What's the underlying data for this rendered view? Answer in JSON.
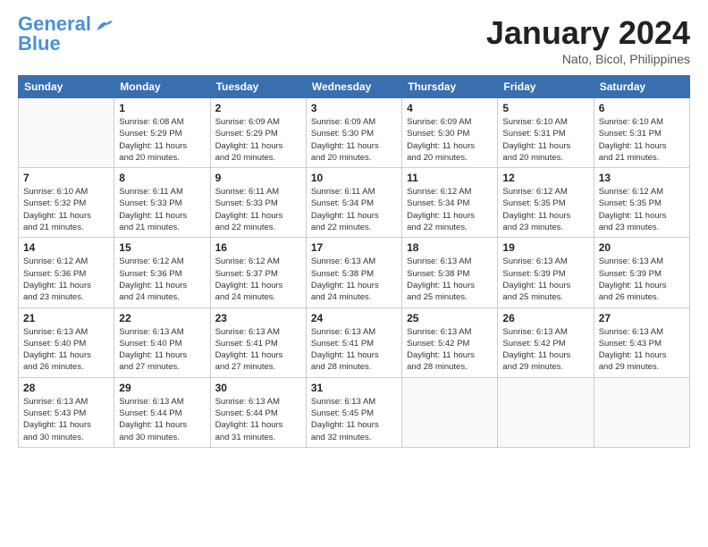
{
  "header": {
    "logo_line1": "General",
    "logo_line2": "Blue",
    "title": "January 2024",
    "subtitle": "Nato, Bicol, Philippines"
  },
  "weekdays": [
    "Sunday",
    "Monday",
    "Tuesday",
    "Wednesday",
    "Thursday",
    "Friday",
    "Saturday"
  ],
  "weeks": [
    [
      {
        "day": "",
        "info": ""
      },
      {
        "day": "1",
        "info": "Sunrise: 6:08 AM\nSunset: 5:29 PM\nDaylight: 11 hours\nand 20 minutes."
      },
      {
        "day": "2",
        "info": "Sunrise: 6:09 AM\nSunset: 5:29 PM\nDaylight: 11 hours\nand 20 minutes."
      },
      {
        "day": "3",
        "info": "Sunrise: 6:09 AM\nSunset: 5:30 PM\nDaylight: 11 hours\nand 20 minutes."
      },
      {
        "day": "4",
        "info": "Sunrise: 6:09 AM\nSunset: 5:30 PM\nDaylight: 11 hours\nand 20 minutes."
      },
      {
        "day": "5",
        "info": "Sunrise: 6:10 AM\nSunset: 5:31 PM\nDaylight: 11 hours\nand 20 minutes."
      },
      {
        "day": "6",
        "info": "Sunrise: 6:10 AM\nSunset: 5:31 PM\nDaylight: 11 hours\nand 21 minutes."
      }
    ],
    [
      {
        "day": "7",
        "info": "Sunrise: 6:10 AM\nSunset: 5:32 PM\nDaylight: 11 hours\nand 21 minutes."
      },
      {
        "day": "8",
        "info": "Sunrise: 6:11 AM\nSunset: 5:33 PM\nDaylight: 11 hours\nand 21 minutes."
      },
      {
        "day": "9",
        "info": "Sunrise: 6:11 AM\nSunset: 5:33 PM\nDaylight: 11 hours\nand 22 minutes."
      },
      {
        "day": "10",
        "info": "Sunrise: 6:11 AM\nSunset: 5:34 PM\nDaylight: 11 hours\nand 22 minutes."
      },
      {
        "day": "11",
        "info": "Sunrise: 6:12 AM\nSunset: 5:34 PM\nDaylight: 11 hours\nand 22 minutes."
      },
      {
        "day": "12",
        "info": "Sunrise: 6:12 AM\nSunset: 5:35 PM\nDaylight: 11 hours\nand 23 minutes."
      },
      {
        "day": "13",
        "info": "Sunrise: 6:12 AM\nSunset: 5:35 PM\nDaylight: 11 hours\nand 23 minutes."
      }
    ],
    [
      {
        "day": "14",
        "info": "Sunrise: 6:12 AM\nSunset: 5:36 PM\nDaylight: 11 hours\nand 23 minutes."
      },
      {
        "day": "15",
        "info": "Sunrise: 6:12 AM\nSunset: 5:36 PM\nDaylight: 11 hours\nand 24 minutes."
      },
      {
        "day": "16",
        "info": "Sunrise: 6:12 AM\nSunset: 5:37 PM\nDaylight: 11 hours\nand 24 minutes."
      },
      {
        "day": "17",
        "info": "Sunrise: 6:13 AM\nSunset: 5:38 PM\nDaylight: 11 hours\nand 24 minutes."
      },
      {
        "day": "18",
        "info": "Sunrise: 6:13 AM\nSunset: 5:38 PM\nDaylight: 11 hours\nand 25 minutes."
      },
      {
        "day": "19",
        "info": "Sunrise: 6:13 AM\nSunset: 5:39 PM\nDaylight: 11 hours\nand 25 minutes."
      },
      {
        "day": "20",
        "info": "Sunrise: 6:13 AM\nSunset: 5:39 PM\nDaylight: 11 hours\nand 26 minutes."
      }
    ],
    [
      {
        "day": "21",
        "info": "Sunrise: 6:13 AM\nSunset: 5:40 PM\nDaylight: 11 hours\nand 26 minutes."
      },
      {
        "day": "22",
        "info": "Sunrise: 6:13 AM\nSunset: 5:40 PM\nDaylight: 11 hours\nand 27 minutes."
      },
      {
        "day": "23",
        "info": "Sunrise: 6:13 AM\nSunset: 5:41 PM\nDaylight: 11 hours\nand 27 minutes."
      },
      {
        "day": "24",
        "info": "Sunrise: 6:13 AM\nSunset: 5:41 PM\nDaylight: 11 hours\nand 28 minutes."
      },
      {
        "day": "25",
        "info": "Sunrise: 6:13 AM\nSunset: 5:42 PM\nDaylight: 11 hours\nand 28 minutes."
      },
      {
        "day": "26",
        "info": "Sunrise: 6:13 AM\nSunset: 5:42 PM\nDaylight: 11 hours\nand 29 minutes."
      },
      {
        "day": "27",
        "info": "Sunrise: 6:13 AM\nSunset: 5:43 PM\nDaylight: 11 hours\nand 29 minutes."
      }
    ],
    [
      {
        "day": "28",
        "info": "Sunrise: 6:13 AM\nSunset: 5:43 PM\nDaylight: 11 hours\nand 30 minutes."
      },
      {
        "day": "29",
        "info": "Sunrise: 6:13 AM\nSunset: 5:44 PM\nDaylight: 11 hours\nand 30 minutes."
      },
      {
        "day": "30",
        "info": "Sunrise: 6:13 AM\nSunset: 5:44 PM\nDaylight: 11 hours\nand 31 minutes."
      },
      {
        "day": "31",
        "info": "Sunrise: 6:13 AM\nSunset: 5:45 PM\nDaylight: 11 hours\nand 32 minutes."
      },
      {
        "day": "",
        "info": ""
      },
      {
        "day": "",
        "info": ""
      },
      {
        "day": "",
        "info": ""
      }
    ]
  ]
}
